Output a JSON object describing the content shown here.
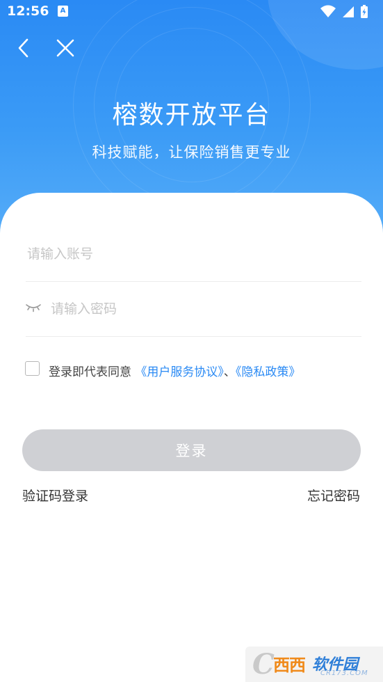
{
  "status_bar": {
    "time": "12:56",
    "app_icon_letter": "A",
    "icons": [
      "wifi-icon",
      "signal-icon",
      "battery-charging-icon"
    ]
  },
  "nav": {
    "back_icon": "chevron-left-icon",
    "close_icon": "close-icon"
  },
  "header": {
    "title": "榕数开放平台",
    "subtitle": "科技赋能，让保险销售更专业"
  },
  "form": {
    "account_placeholder": "请输入账号",
    "password_placeholder": "请输入密码",
    "password_visibility_icon": "eye-closed-icon"
  },
  "agreement": {
    "checked": false,
    "prefix": "登录即代表同意",
    "user_agreement": "《用户服务协议》",
    "separator": "、",
    "privacy_policy": "《隐私政策》"
  },
  "actions": {
    "login_label": "登录",
    "sms_login_label": "验证码登录",
    "forgot_password_label": "忘记密码"
  },
  "watermark": {
    "orange_text": "西西",
    "blue_text": "软件园",
    "sub_text": "CR173.COM"
  },
  "colors": {
    "primary_blue": "#2a8af4",
    "disabled_button": "#cfd0d4",
    "placeholder": "#c6c6c6"
  }
}
